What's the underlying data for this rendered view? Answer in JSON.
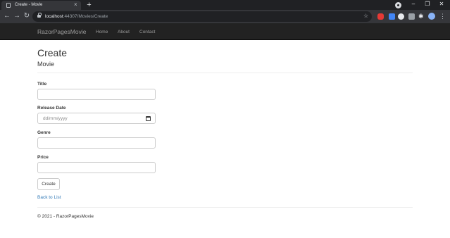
{
  "browser": {
    "tab_title": "Create - Movie",
    "tab_close": "×",
    "new_tab": "+",
    "url_host": "localhost",
    "url_path": ":44307/Movies/Create",
    "back": "←",
    "forward": "→",
    "reload": "↻",
    "star": "☆",
    "puzzle": "✱",
    "menu": "⋮",
    "minimize": "–",
    "maximize": "❐",
    "close": "✕",
    "icons": [
      "tab-favicon-icon",
      "lock-icon",
      "star-icon",
      "extension-icon",
      "puzzle-icon",
      "avatar-icon",
      "more-icon"
    ]
  },
  "navbar": {
    "brand": "RazorPagesMovie",
    "links": [
      "Home",
      "About",
      "Contact"
    ]
  },
  "page": {
    "title": "Create",
    "subtitle": "Movie",
    "fields": [
      {
        "label": "Title",
        "value": ""
      },
      {
        "label": "Release Date",
        "placeholder": "dd/mm/yyyy"
      },
      {
        "label": "Genre",
        "value": ""
      },
      {
        "label": "Price",
        "value": ""
      }
    ],
    "submit": "Create",
    "back_link": "Back to List"
  },
  "footer": {
    "text": "© 2021 - RazorPagesMovie"
  },
  "colors": {
    "navbar_bg": "#222222",
    "nav_text": "#9d9d9d",
    "link": "#337ab7",
    "chrome_bg": "#202124"
  }
}
